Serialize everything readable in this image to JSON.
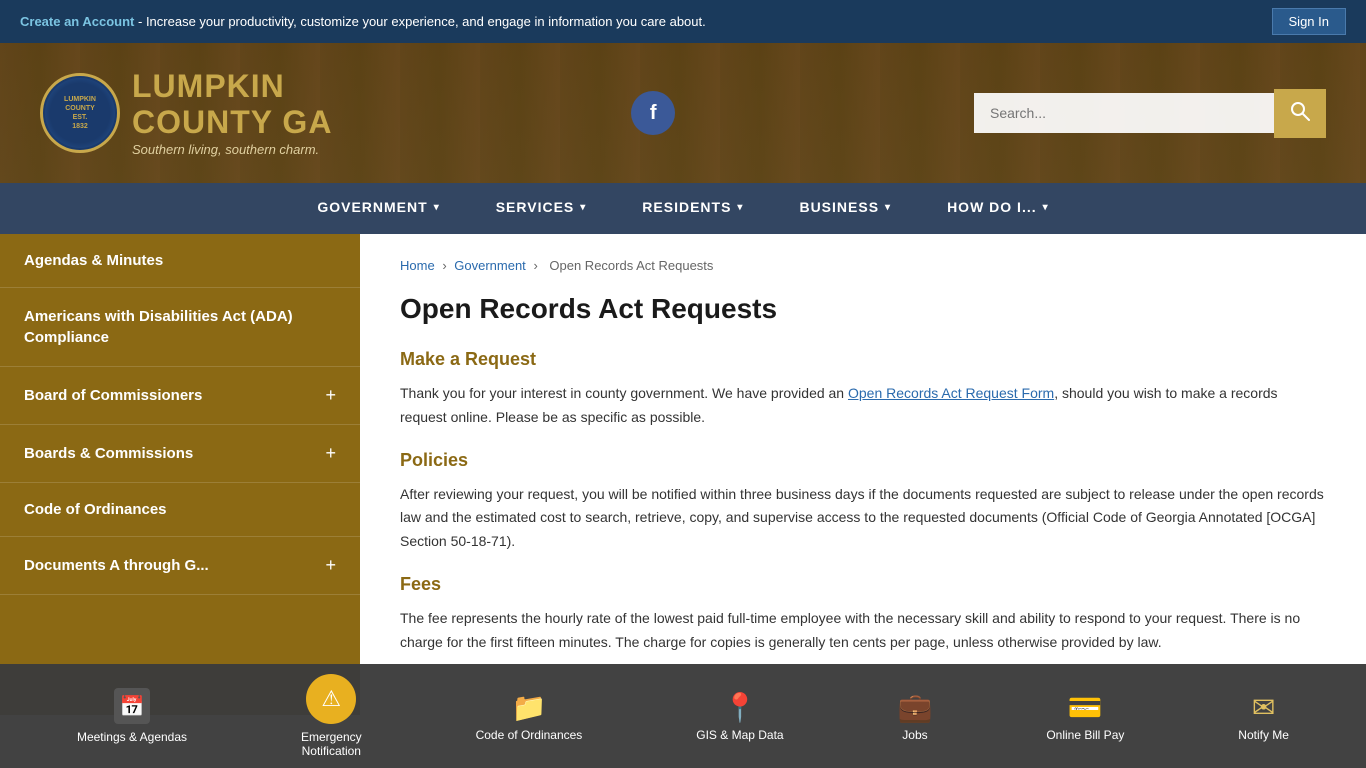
{
  "topBanner": {
    "createAccountText": "Create an Account",
    "bannerText": " - Increase your productivity, customize your experience, and engage in information you care about.",
    "signInLabel": "Sign In"
  },
  "header": {
    "logoSubtext": "Southern living, southern charm.",
    "logoLine1": "LUMPKIN",
    "logoLine2": "COUNTY",
    "logoLine3": "GA",
    "searchPlaceholder": "Search...",
    "facebookLabel": "f"
  },
  "nav": {
    "items": [
      {
        "label": "GOVERNMENT",
        "hasArrow": true
      },
      {
        "label": "SERVICES",
        "hasArrow": true
      },
      {
        "label": "RESIDENTS",
        "hasArrow": true
      },
      {
        "label": "BUSINESS",
        "hasArrow": true
      },
      {
        "label": "HOW DO I...",
        "hasArrow": true
      }
    ]
  },
  "sidebar": {
    "items": [
      {
        "label": "Agendas & Minutes",
        "hasPlus": false
      },
      {
        "label": "Americans with Disabilities Act (ADA) Compliance",
        "hasPlus": false
      },
      {
        "label": "Board of Commissioners",
        "hasPlus": true
      },
      {
        "label": "Boards & Commissions",
        "hasPlus": true
      },
      {
        "label": "Code of Ordinances",
        "hasPlus": false
      },
      {
        "label": "Documents A through G...",
        "hasPlus": true
      }
    ]
  },
  "breadcrumb": {
    "home": "Home",
    "government": "Government",
    "current": "Open Records Act Requests"
  },
  "mainContent": {
    "pageTitle": "Open Records Act Requests",
    "section1Title": "Make a Request",
    "section1Text1": "Thank you for your interest in county government. We have provided an ",
    "section1LinkText": "Open Records Act Request Form",
    "section1Text2": ", should you wish to make a records request online. Please be as specific as possible.",
    "section2Title": "Policies",
    "section2Text": "After reviewing your request, you will be notified within three business days if the documents requested are subject to release under the open records law and the estimated cost to search, retrieve, copy, and supervise access to the requested documents (Official Code of Georgia Annotated [OCGA] Section 50-18-71).",
    "section3Title": "Fees",
    "section3Text": "The fee represents the hourly rate of the lowest paid full-time employee with the necessary skill and ability to respond to your request. There is no charge for the first fifteen minutes. The charge for copies is generally ten cents per page, unless otherwise provided by law."
  },
  "quickLinks": [
    {
      "label": "Meetings & Agendas",
      "icon": "📅",
      "type": "calendar"
    },
    {
      "label": "Emergency\nNotification",
      "icon": "⚠",
      "type": "warning"
    },
    {
      "label": "Code of Ordinances",
      "icon": "📁",
      "type": "folder"
    },
    {
      "label": "GIS & Map Data",
      "icon": "📍",
      "type": "pin"
    },
    {
      "label": "Jobs",
      "icon": "💼",
      "type": "briefcase"
    },
    {
      "label": "Online Bill Pay",
      "icon": "💳",
      "type": "card"
    },
    {
      "label": "Notify Me",
      "icon": "✉",
      "type": "envelope"
    }
  ]
}
